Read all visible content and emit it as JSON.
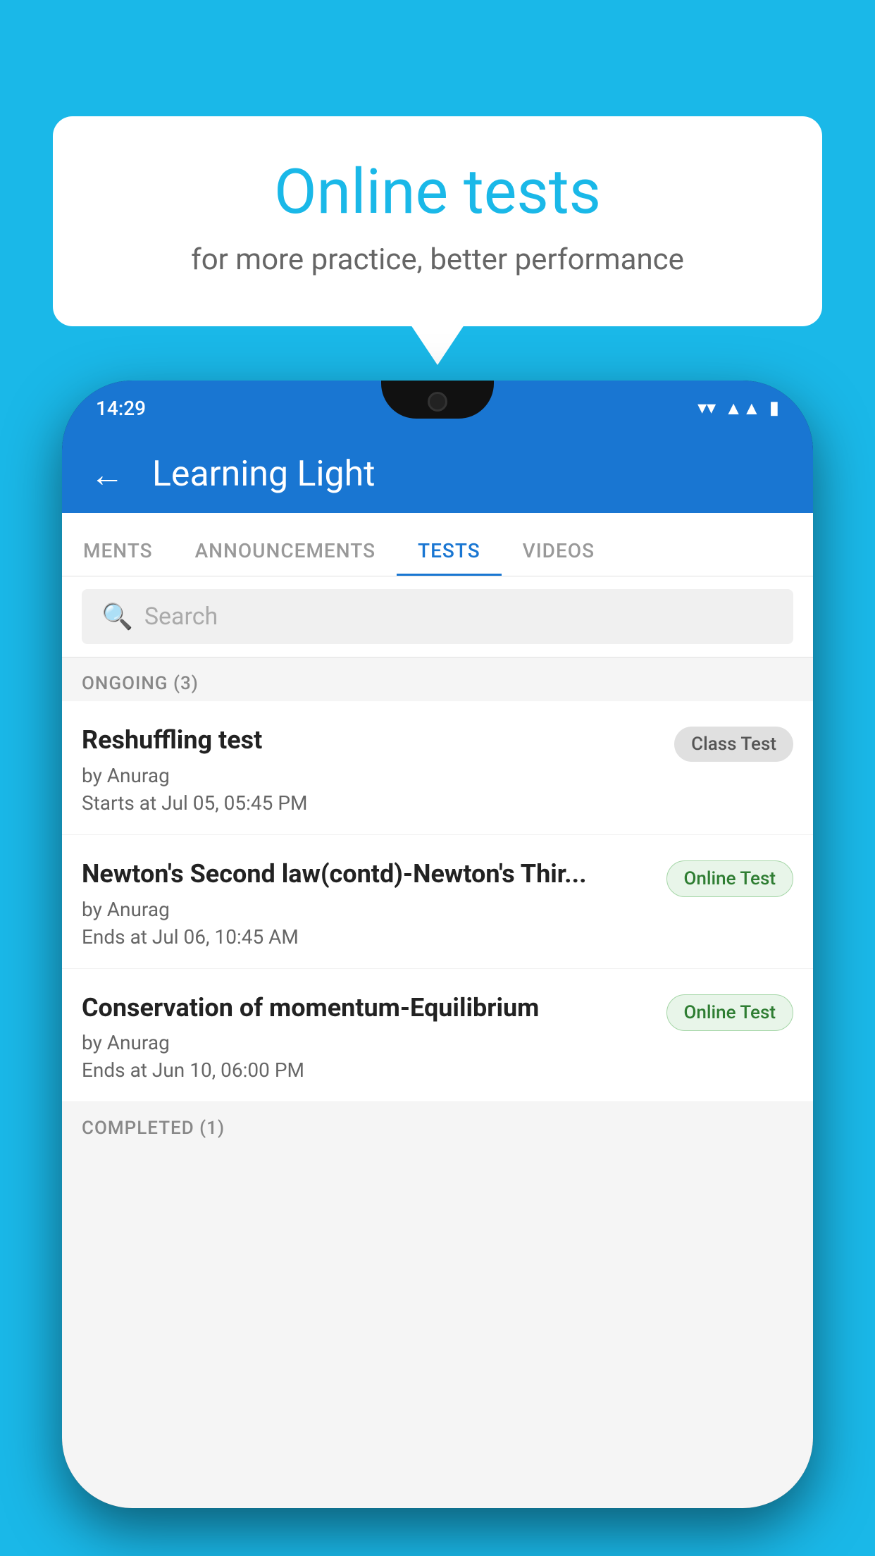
{
  "background": {
    "color": "#1ab8e8"
  },
  "speech_bubble": {
    "title": "Online tests",
    "subtitle": "for more practice, better performance"
  },
  "phone": {
    "status_bar": {
      "time": "14:29",
      "wifi_icon": "▼",
      "signal_icon": "▲",
      "battery_icon": "▮"
    },
    "app_bar": {
      "back_label": "←",
      "title": "Learning Light"
    },
    "tabs": [
      {
        "label": "MENTS",
        "active": false
      },
      {
        "label": "ANNOUNCEMENTS",
        "active": false
      },
      {
        "label": "TESTS",
        "active": true
      },
      {
        "label": "VIDEOS",
        "active": false
      }
    ],
    "search": {
      "placeholder": "Search"
    },
    "ongoing_section": {
      "header": "ONGOING (3)",
      "items": [
        {
          "title": "Reshuffling test",
          "by": "by Anurag",
          "time_label": "Starts at",
          "time": "Jul 05, 05:45 PM",
          "badge": "Class Test",
          "badge_type": "class"
        },
        {
          "title": "Newton's Second law(contd)-Newton's Thir...",
          "by": "by Anurag",
          "time_label": "Ends at",
          "time": "Jul 06, 10:45 AM",
          "badge": "Online Test",
          "badge_type": "online"
        },
        {
          "title": "Conservation of momentum-Equilibrium",
          "by": "by Anurag",
          "time_label": "Ends at",
          "time": "Jun 10, 06:00 PM",
          "badge": "Online Test",
          "badge_type": "online"
        }
      ]
    },
    "completed_section": {
      "header": "COMPLETED (1)"
    }
  }
}
